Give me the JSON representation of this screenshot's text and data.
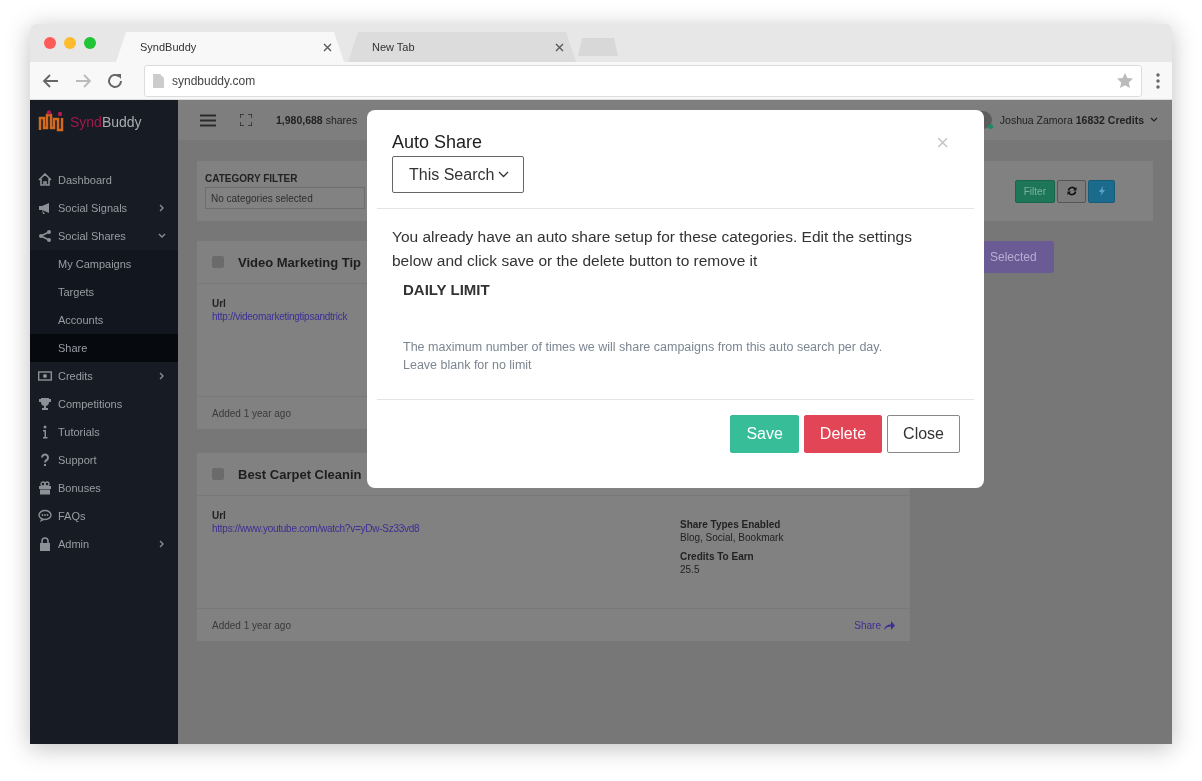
{
  "browser": {
    "tabs": [
      {
        "label": "SyndBuddy",
        "selected": true
      },
      {
        "label": "New Tab",
        "selected": false
      }
    ],
    "address": "syndbuddy.com"
  },
  "sidebar": {
    "logo": {
      "text_1": "Synd",
      "text_2": "Buddy"
    },
    "items": [
      {
        "label": "Dashboard",
        "kind": "link",
        "selected": false
      },
      {
        "label": "Social Signals",
        "kind": "menu",
        "expanded": false,
        "selected": false
      },
      {
        "label": "Social Shares",
        "kind": "menu",
        "expanded": true,
        "selected": false,
        "children": [
          {
            "label": "My Campaigns",
            "selected": false
          },
          {
            "label": "Targets",
            "selected": false
          },
          {
            "label": "Accounts",
            "selected": false
          },
          {
            "label": "Share",
            "selected": true
          }
        ]
      },
      {
        "label": "Credits",
        "kind": "menu",
        "expanded": false,
        "selected": false
      },
      {
        "label": "Competitions",
        "kind": "link",
        "selected": false
      },
      {
        "label": "Tutorials",
        "kind": "link",
        "selected": false
      },
      {
        "label": "Support",
        "kind": "link",
        "selected": false
      },
      {
        "label": "Bonuses",
        "kind": "link",
        "selected": false
      },
      {
        "label": "FAQs",
        "kind": "link",
        "selected": false
      },
      {
        "label": "Admin",
        "kind": "menu",
        "expanded": false,
        "selected": false
      }
    ]
  },
  "topbar": {
    "stats": "**1,980,688** shares",
    "user": "Joshua Zamora **16832 Credits**"
  },
  "filter": {
    "label": "CATEGORY FILTER",
    "placeholder": "No categories selected",
    "button": "Filter",
    "selected_button": "Selected"
  },
  "campaigns": [
    {
      "title": "Video Marketing Tip",
      "checked": false,
      "url_label": "Url",
      "url": "http://videomarketingtipsandtrick",
      "added": "Added 1 year ago"
    },
    {
      "title": "Best Carpet Cleanin",
      "checked": false,
      "url_label": "Url",
      "url": "https://www.youtube.com/watch?v=yDw-Sz33vd8",
      "share_types_label": "Share Types Enabled",
      "share_types": "Blog, Social, Bookmark",
      "credits_label": "Credits To Earn",
      "credits": "25.5",
      "added": "Added 1 year ago",
      "share_link": "Share"
    }
  ],
  "modal": {
    "title": "Auto Share",
    "close": "×",
    "dropdown": "This Search",
    "message": "You already have an auto share setup for these categories. Edit the settings below and click save or the delete button to remove it",
    "section": "DAILY LIMIT",
    "help": "The maximum number of times we will share campaigns from this auto search per day. Leave blank for no limit",
    "buttons": [
      {
        "label": "Save",
        "kind": "primary"
      },
      {
        "label": "Delete",
        "kind": "danger"
      },
      {
        "label": "Close",
        "kind": "plain"
      }
    ]
  }
}
